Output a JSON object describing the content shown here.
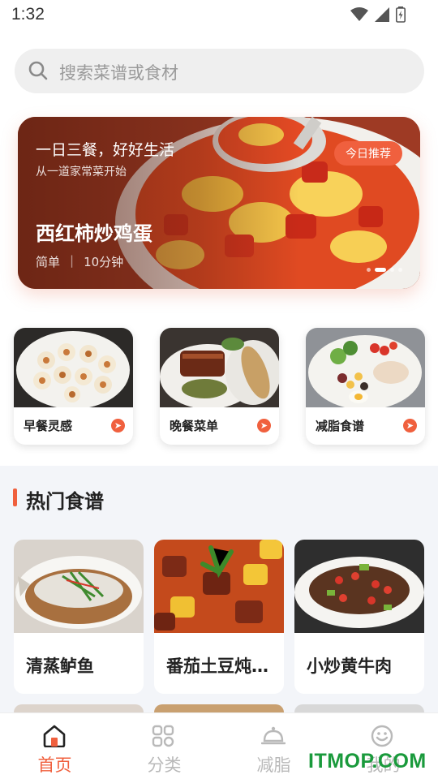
{
  "status_bar": {
    "time": "1:32"
  },
  "search": {
    "placeholder": "搜索菜谱或食材",
    "icon": "search-icon"
  },
  "banner": {
    "slogan": "一日三餐，好好生活",
    "subtitle": "从一道家常菜开始",
    "title": "西红柿炒鸡蛋",
    "difficulty": "简单",
    "separator": "|",
    "duration": "10分钟",
    "badge": "今日推荐",
    "slide_count": 4,
    "active_slide": 1
  },
  "categories": [
    {
      "label": "早餐灵感",
      "icon": "arrow-right-icon"
    },
    {
      "label": "晚餐菜单",
      "icon": "arrow-right-icon"
    },
    {
      "label": "减脂食谱",
      "icon": "arrow-right-icon"
    }
  ],
  "hot": {
    "title": "热门食谱",
    "recipes": [
      {
        "title": "清蒸鲈鱼"
      },
      {
        "title": "番茄土豆炖牛腩"
      },
      {
        "title": "小炒黄牛肉"
      }
    ]
  },
  "tabbar": {
    "tabs": [
      {
        "label": "首页",
        "icon": "home-icon",
        "active": true
      },
      {
        "label": "分类",
        "icon": "grid-icon",
        "active": false
      },
      {
        "label": "减脂",
        "icon": "cloche-icon",
        "active": false
      },
      {
        "label": "我的",
        "icon": "smiley-icon",
        "active": false
      }
    ]
  },
  "watermark": "ITMOP.COM",
  "colors": {
    "accent": "#f0603e",
    "inactive": "#b9b9b9",
    "section_bg": "#f3f5f9",
    "watermark": "#1a9a3c"
  }
}
